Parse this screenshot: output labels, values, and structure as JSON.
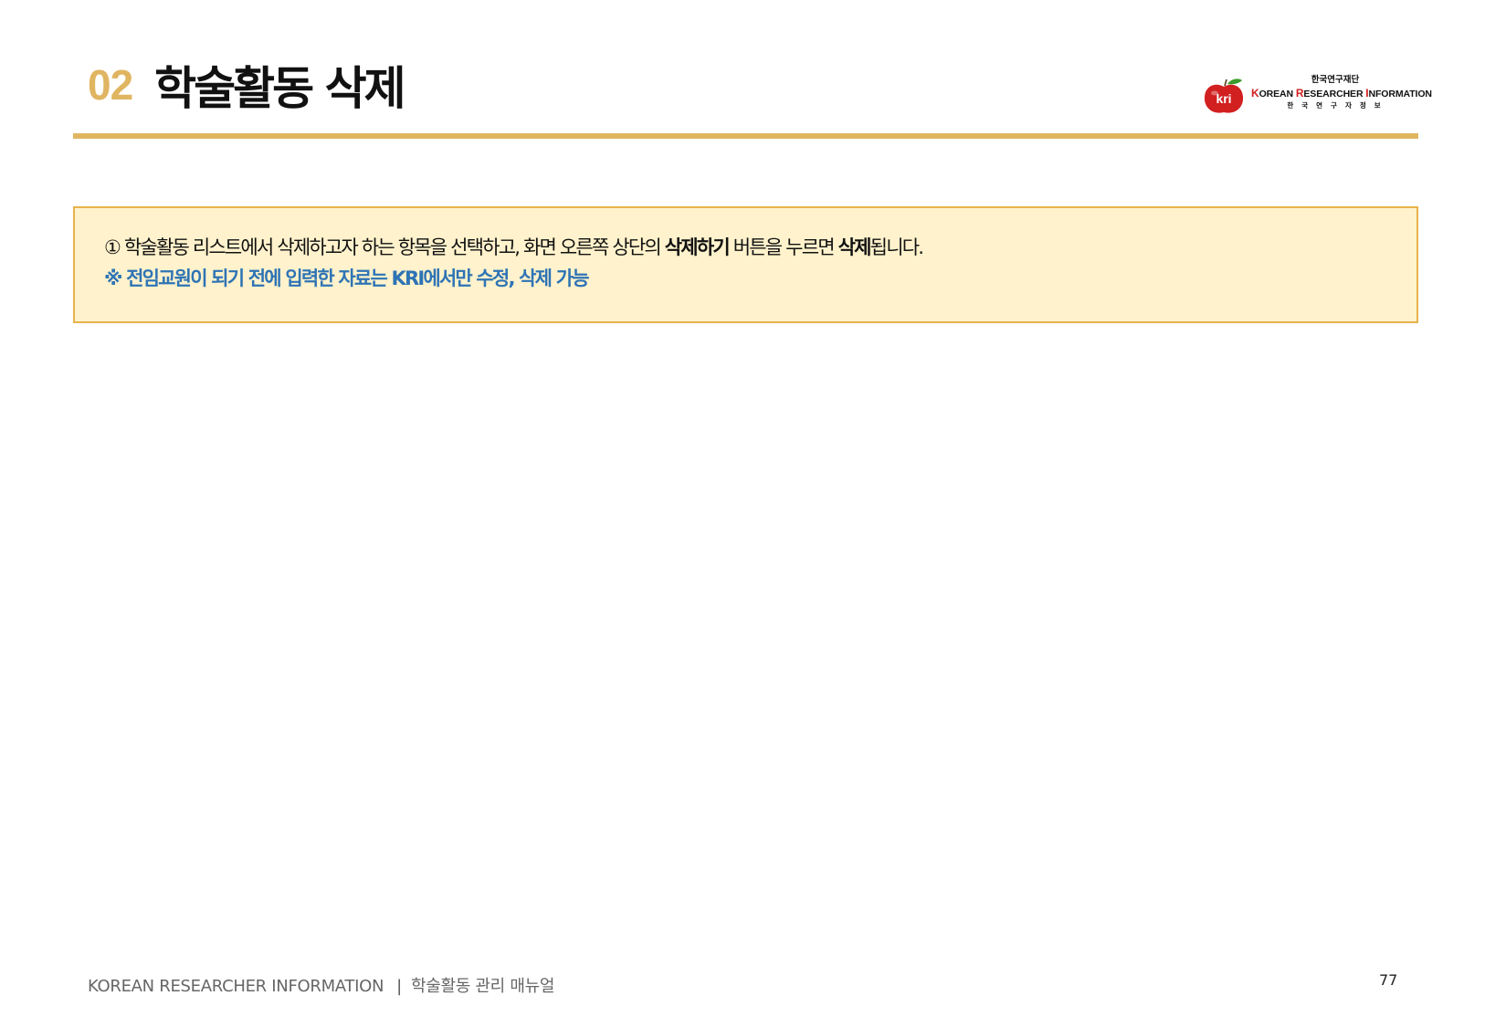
{
  "header": {
    "section_number": "02",
    "title": "학술활동 삭제"
  },
  "logo": {
    "badge_text": "kri",
    "org_name": "한국연구재단",
    "english_name_parts": [
      {
        "cap": "K",
        "rest": "OREAN "
      },
      {
        "cap": "R",
        "rest": "ESEARCHER "
      },
      {
        "cap": "I",
        "rest": "NFORMATION"
      }
    ],
    "korean_name": "한국연구자정보",
    "colors": {
      "apple": "#D21F1F",
      "leaf": "#3A9A2A"
    }
  },
  "notice": {
    "line1": {
      "prefix": "① 학술활동 리스트에서 삭제하고자 하는 항목을 선택하고, 화면 오른쪽 상단의 ",
      "bold1": "삭제하기",
      "middle": " 버튼을 누르면 ",
      "bold2": "삭제",
      "suffix": "됩니다."
    },
    "line2": "※ 전임교원이 되기 전에 입력한 자료는 KRI에서만 수정, 삭제 가능"
  },
  "footer": {
    "left_text": "KOREAN RESEARCHER INFORMATION",
    "separator": "|",
    "manual_name": "학술활동 관리 매뉴얼",
    "page_number": "77"
  },
  "colors": {
    "accent": "#E0B561",
    "notice_bg": "#FFF2CC",
    "notice_border": "#E8B24A",
    "link_blue": "#2E74B5"
  }
}
